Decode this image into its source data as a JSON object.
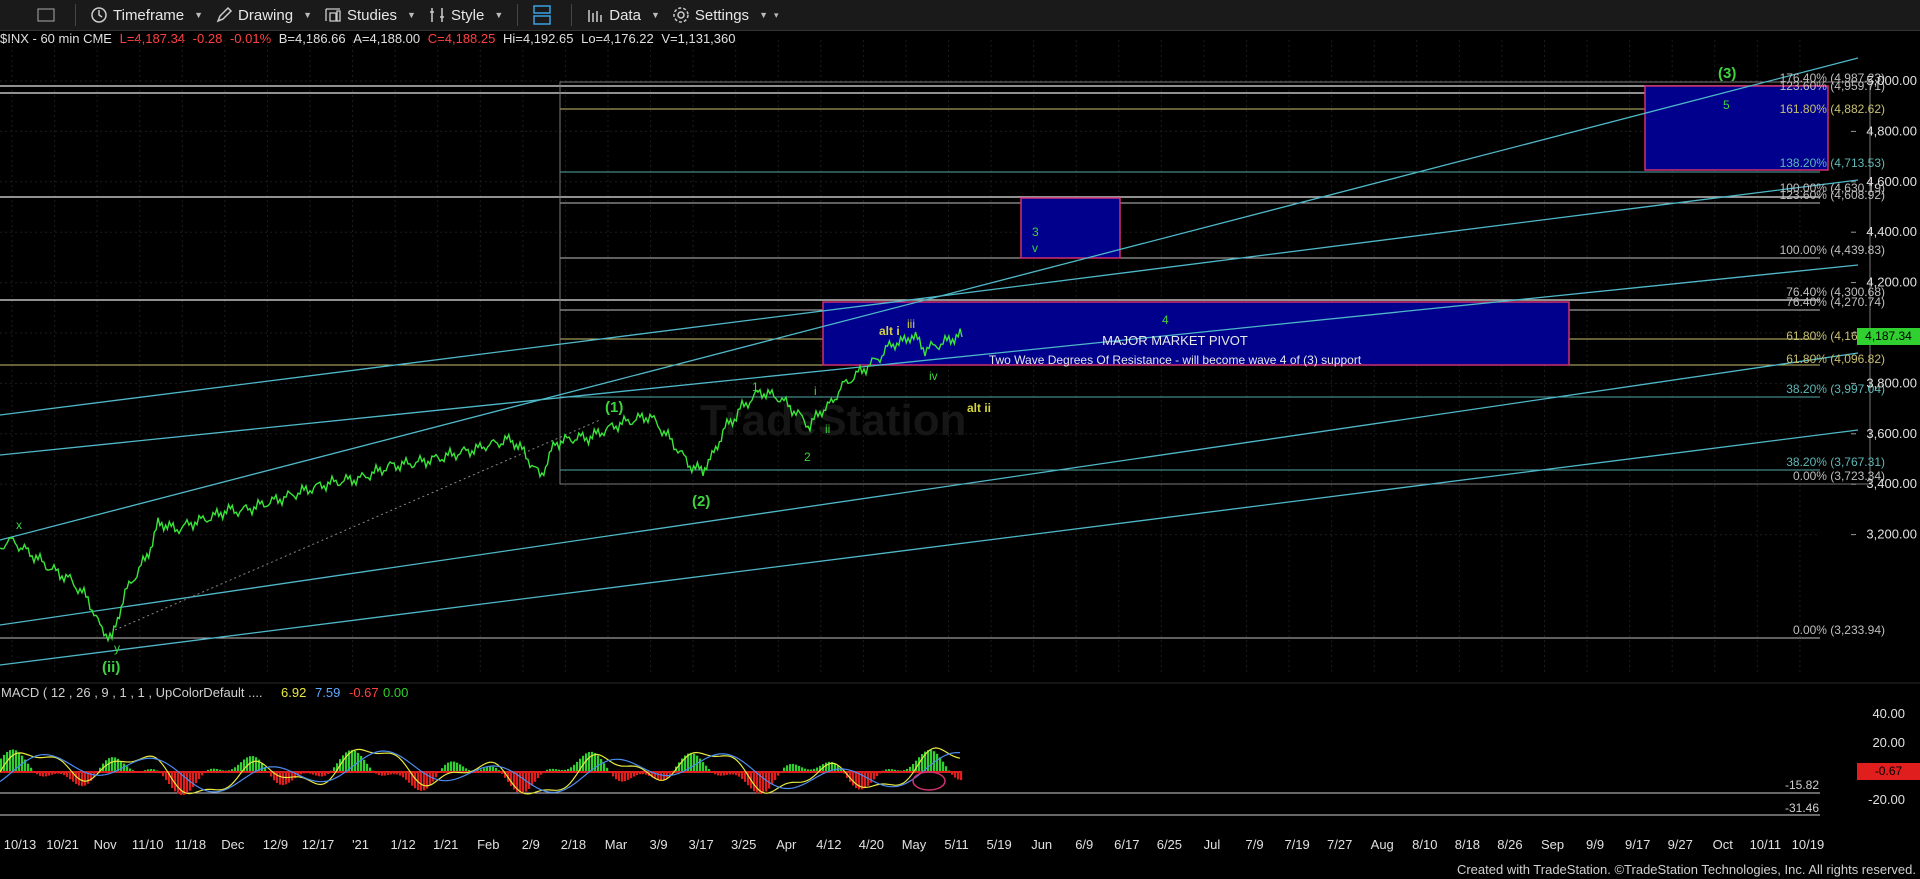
{
  "toolbar": {
    "timeframe": "Timeframe",
    "drawing": "Drawing",
    "studies": "Studies",
    "style": "Style",
    "data": "Data",
    "settings": "Settings"
  },
  "header": {
    "symbol": "$INX - 60 min CME",
    "last": "L=4,187.34",
    "change": "-0.28",
    "pct": "-0.01%",
    "bid": "B=4,186.66",
    "ask": "A=4,188.00",
    "close": "C=4,188.25",
    "high": "Hi=4,192.65",
    "low": "Lo=4,176.22",
    "volume": "V=1,131,360"
  },
  "price_axis": [
    "5,000.00",
    "4,800.00",
    "4,600.00",
    "4,400.00",
    "4,200.00",
    "4,000.00",
    "3,800.00",
    "3,600.00",
    "3,400.00",
    "3,200.00"
  ],
  "last_price": "4,187.34",
  "macd": {
    "label": "MACD ( 12 , 26 , 9 , 1 , 1 , UpColorDefault ....",
    "v1": "6.92",
    "v2": "7.59",
    "v3": "-0.67",
    "v4": "0.00",
    "axis": [
      "40.00",
      "20.00",
      "-20.00"
    ],
    "badge_low": "-0.67",
    "level1": "-15.82",
    "level2": "-31.46"
  },
  "time_axis": [
    "10/13",
    "10/21",
    "Nov",
    "11/10",
    "11/18",
    "Dec",
    "12/9",
    "12/17",
    "'21",
    "1/12",
    "1/21",
    "Feb",
    "2/9",
    "2/18",
    "Mar",
    "3/9",
    "3/17",
    "3/25",
    "Apr",
    "4/12",
    "4/20",
    "May",
    "5/11",
    "5/19",
    "Jun",
    "6/9",
    "6/17",
    "6/25",
    "Jul",
    "7/9",
    "7/19",
    "7/27",
    "Aug",
    "8/10",
    "8/18",
    "8/26",
    "Sep",
    "9/9",
    "9/17",
    "9/27",
    "Oct",
    "10/11",
    "10/19"
  ],
  "fib_labels": [
    {
      "text": "176.40% (4,987.23)",
      "color": "#bfbfbf"
    },
    {
      "text": "123.60% (4,959.71)",
      "color": "#bfbfbf"
    },
    {
      "text": "161.80% (4,882.62)",
      "color": "#c8c070"
    },
    {
      "text": "138.20% (4,713.53)",
      "color": "#5fb8b8"
    },
    {
      "text": "100.00% (4,630.19)",
      "color": "#bfbfbf"
    },
    {
      "text": "123.60% (4,608.92)",
      "color": "#bfbfbf"
    },
    {
      "text": "100.00% (4,439.83)",
      "color": "#bfbfbf"
    },
    {
      "text": "76.40% (4,300.68)",
      "color": "#bfbfbf"
    },
    {
      "text": "76.40% (4,270.74)",
      "color": "#bfbfbf"
    },
    {
      "text": "61.80% (4,166.13)",
      "color": "#c8c070"
    },
    {
      "text": "61.80% (4,096.82)",
      "color": "#c8c070"
    },
    {
      "text": "38.20% (3,997.04)",
      "color": "#5fb8b8"
    },
    {
      "text": "38.20% (3,767.31)",
      "color": "#5fb8b8"
    },
    {
      "text": "0.00% (3,723.34)",
      "color": "#bfbfbf"
    },
    {
      "text": "0.00% (3,233.94)",
      "color": "#bfbfbf"
    }
  ],
  "annotations": {
    "pivot_title": "MAJOR MARKET PIVOT",
    "pivot_sub": "Two Wave Degrees Of Resistance - will become wave 4 of (3) support",
    "w3big": "(3)",
    "w5": "5",
    "w3": "3",
    "wv": "v",
    "w4": "4",
    "w1big": "(1)",
    "w2big": "(2)",
    "wiibig": "(ii)",
    "wx": "x",
    "wy": "y",
    "w1": "1",
    "w2": "2",
    "wi": "i",
    "wii": "ii",
    "wiii": "iii",
    "wiv": "iv",
    "alti": "alt i",
    "altii": "alt ii",
    "watermark": "TradeStation"
  },
  "credit": "Created with TradeStation. ©TradeStation Technologies, Inc. All rights reserved.",
  "colors": {
    "background": "#000000",
    "channel": "#4fb8c8",
    "price": "#39e639",
    "box_fill": "#00008c",
    "box_border": "#d03070",
    "macd_pos": "#2fd02f",
    "macd_neg": "#e01e1e",
    "label_yellow": "#d4d440",
    "label_green": "#3ed43e"
  }
}
